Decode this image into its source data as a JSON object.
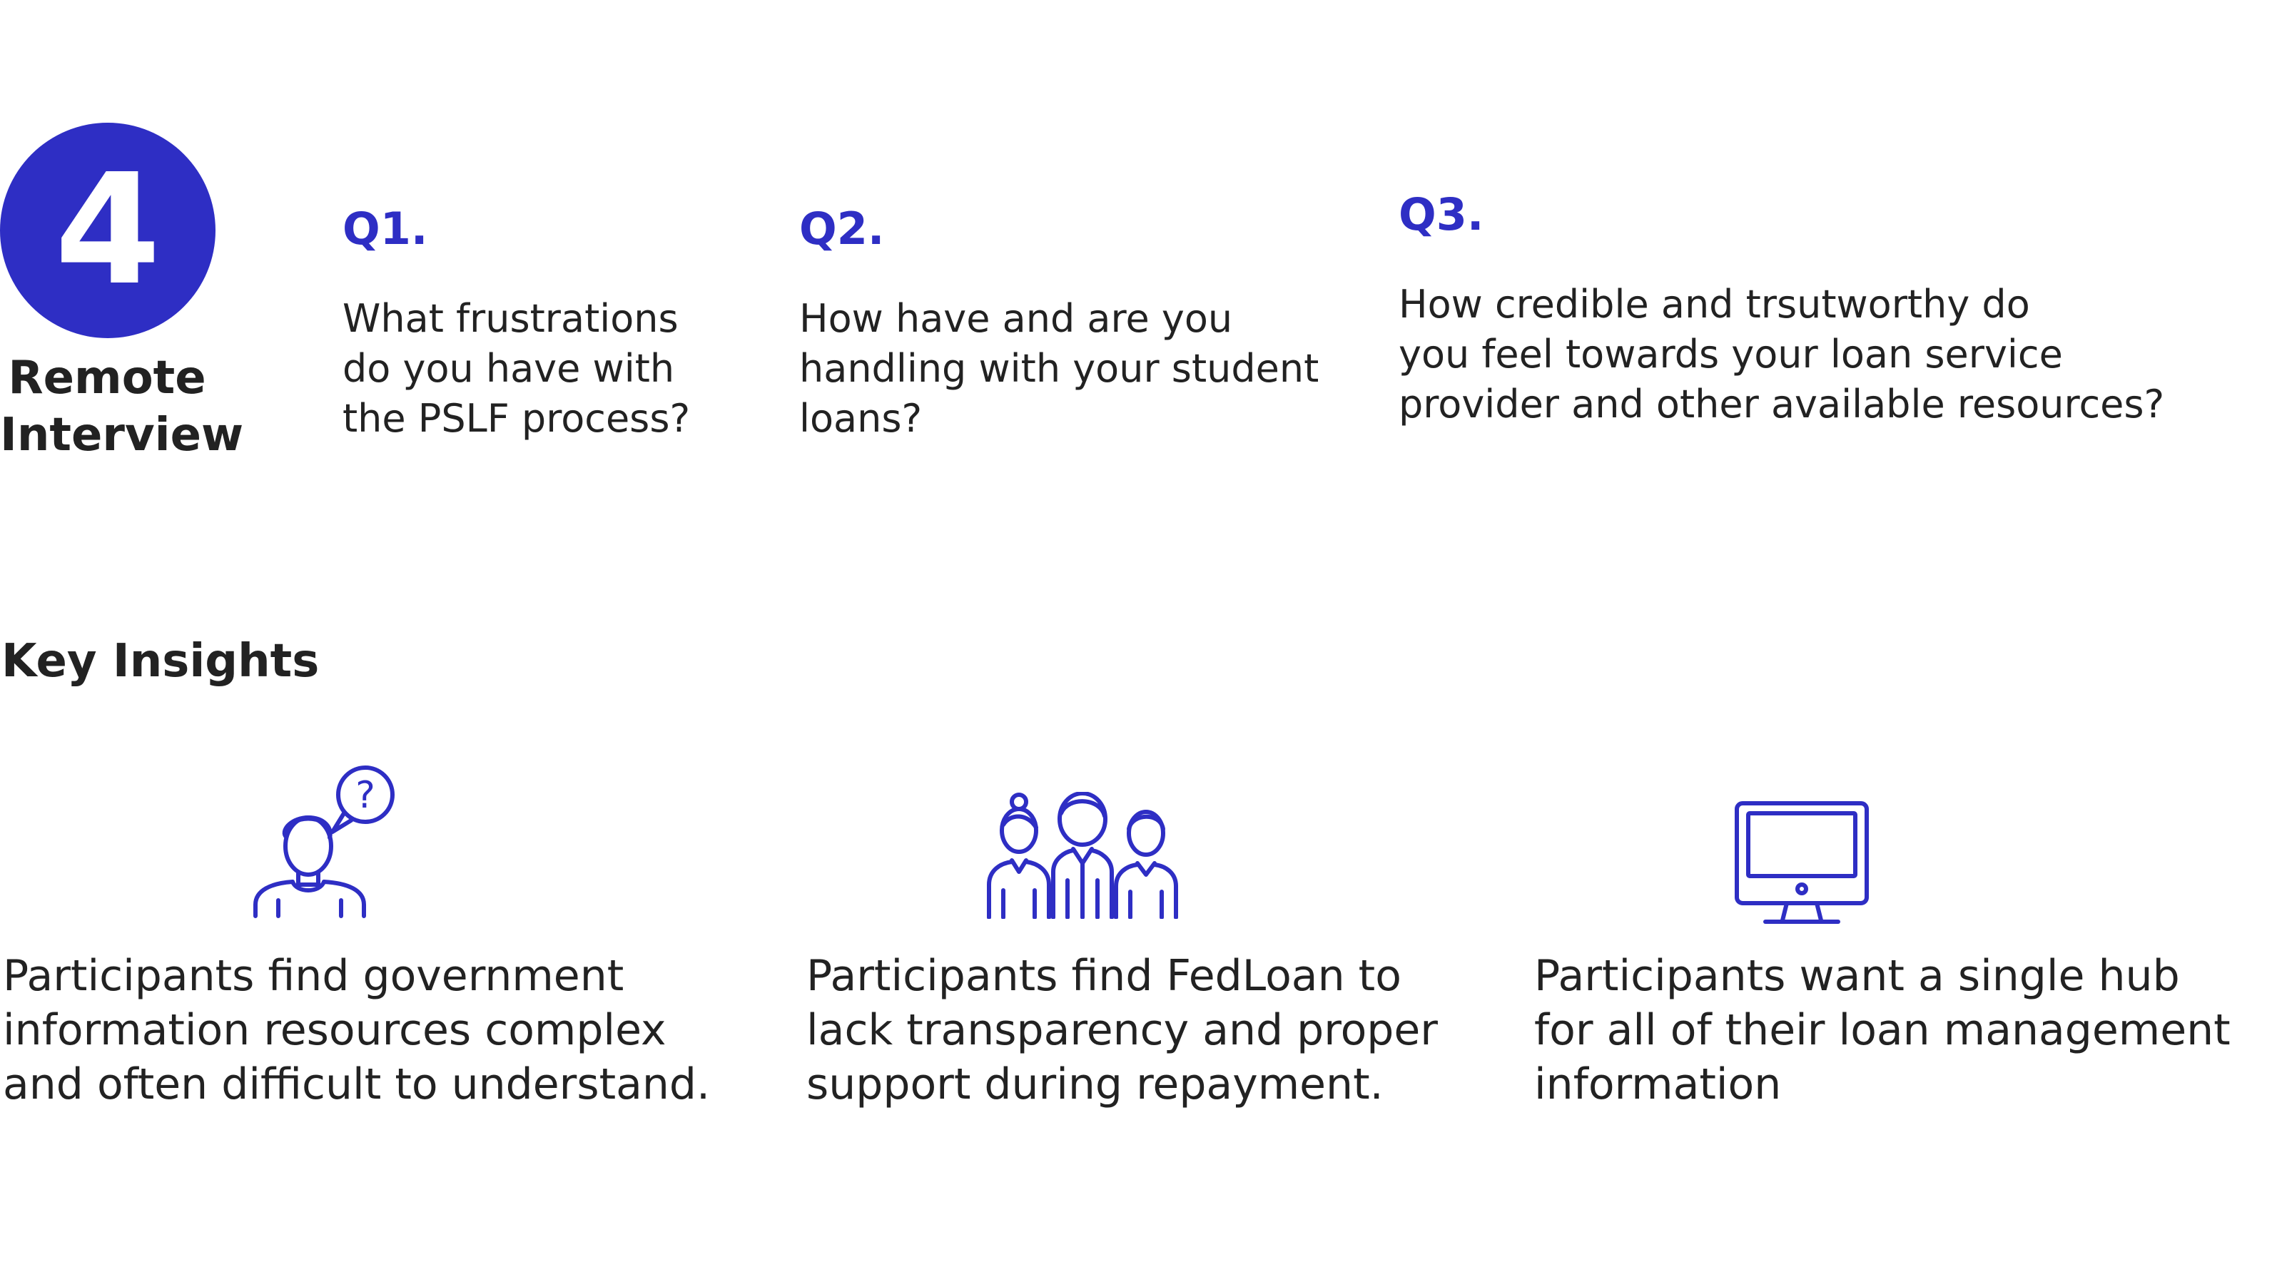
{
  "step": {
    "number": "4",
    "label_line1": "Remote",
    "label_line2": "Interview"
  },
  "questions": [
    {
      "label": "Q1.",
      "text": "What frustrations\ndo you have with\nthe PSLF process?"
    },
    {
      "label": "Q2.",
      "text": "How have and are you\nhandling with your student\nloans?"
    },
    {
      "label": "Q3.",
      "text": "How credible and trsutworthy do\nyou feel towards your loan service\nprovider and other available resources?"
    }
  ],
  "insights": {
    "title": "Key Insights",
    "items": [
      {
        "icon": "confused-person-icon",
        "text": "Participants find government\ninformation resources complex\nand often difficult to understand."
      },
      {
        "icon": "group-of-people-icon",
        "text": "Participants find FedLoan to\nlack transparency and proper\nsupport during repayment."
      },
      {
        "icon": "computer-monitor-icon",
        "text": "Participants want a single hub\nfor all of their loan management\ninformation"
      }
    ]
  },
  "colors": {
    "accent": "#2e2ec4",
    "text": "#222222",
    "background": "#ffffff"
  }
}
